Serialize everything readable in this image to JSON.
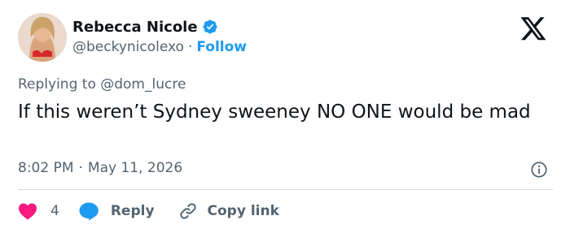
{
  "author": {
    "display_name": "Rebecca Nicole",
    "handle": "@beckynicolexo",
    "separator": "·",
    "follow_label": "Follow",
    "verified_icon": "verified-badge-icon"
  },
  "logo_icon": "x-logo-icon",
  "reply_context": "Replying to @dom_lucre",
  "tweet": {
    "text": "If this weren’t Sydney sweeney NO ONE would be mad",
    "time": "8:02 PM",
    "separator": "·",
    "date": "May 11, 2026"
  },
  "actions": {
    "like_count": "4",
    "reply_label": "Reply",
    "copy_label": "Copy link"
  },
  "colors": {
    "accent": "#1d9bf0",
    "like": "#f91880",
    "muted": "#536471",
    "text": "#0f1419"
  }
}
